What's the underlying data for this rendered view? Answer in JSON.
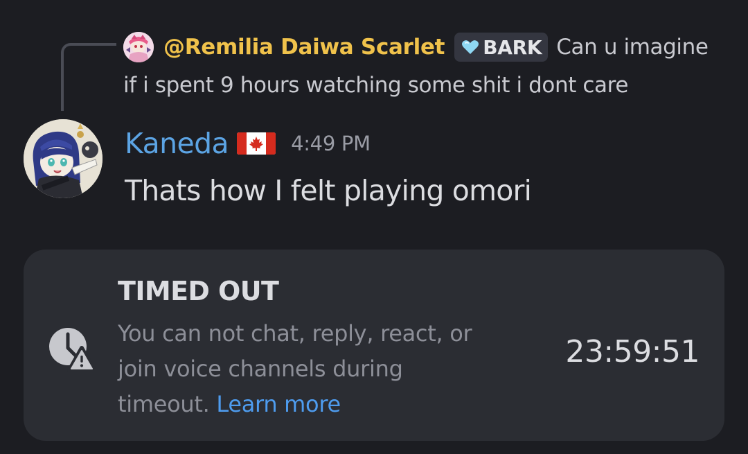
{
  "reply": {
    "author": "@Remilia Daiwa Scarlet",
    "tag": "BARK",
    "text_line1": "Can u imagine",
    "text_line2": "if i spent 9 hours watching some shit i dont care"
  },
  "message": {
    "username": "Kaneda",
    "flag_icon": "canada-flag-icon",
    "timestamp": "4:49 PM",
    "text": "Thats how I felt playing omori"
  },
  "timeout": {
    "icon": "timeout-clock-warning-icon",
    "title": "TIMED OUT",
    "description_part1": "You can not chat, reply, react, or join voice channels during timeout.",
    "learn_more": "Learn more",
    "countdown": "23:59:51"
  },
  "colors": {
    "background": "#1c1d22",
    "card": "#2b2d33",
    "reply_author": "#f0c24b",
    "username": "#5ca4e4",
    "link": "#4e9cef"
  }
}
